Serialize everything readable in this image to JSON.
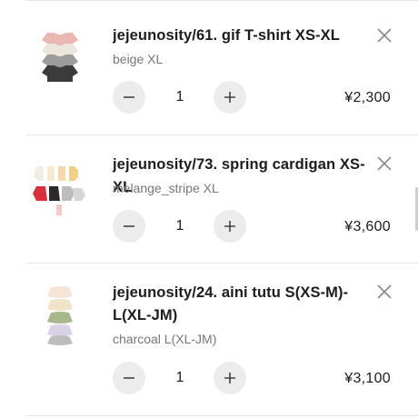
{
  "items": [
    {
      "title": "jejeunosity/61. gif T-shirt XS-XL",
      "variant": "beige XL",
      "quantity": "1",
      "price": "¥2,300",
      "thumbnail_icon": "stacked-tshirts-image"
    },
    {
      "title": "jejeunosity/73. spring cardigan XS-XL",
      "variant": "melange_stripe XL",
      "quantity": "1",
      "price": "¥3,600",
      "thumbnail_icon": "stacked-cardigans-image"
    },
    {
      "title": "jejeunosity/24. aini tutu S(XS-M)-L(XL-JM)",
      "variant": "charcoal L(XL-JM)",
      "quantity": "1",
      "price": "¥3,100",
      "thumbnail_icon": "stacked-tutus-image"
    }
  ],
  "icons": {
    "remove": "close-icon",
    "decrease": "minus-icon",
    "increase": "plus-icon"
  },
  "colors": {
    "text": "#1c1c1c",
    "muted": "#777777",
    "button_bg": "#ececec",
    "divider": "#e8e8e8"
  }
}
